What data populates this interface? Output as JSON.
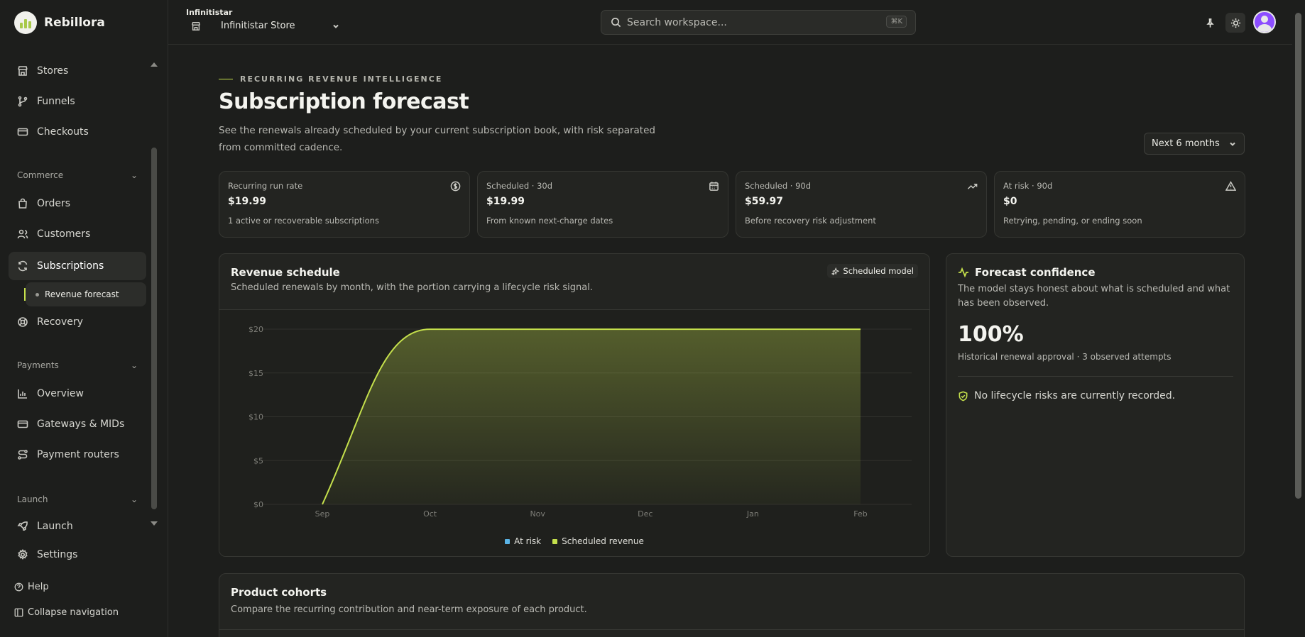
{
  "brand": {
    "name": "Rebillora"
  },
  "nav": {
    "stores": "Stores",
    "funnels": "Funnels",
    "checkouts": "Checkouts",
    "commerce_group": "Commerce",
    "orders": "Orders",
    "customers": "Customers",
    "subscriptions": "Subscriptions",
    "revenue_forecast": "Revenue forecast",
    "recovery": "Recovery",
    "payments_group": "Payments",
    "overview": "Overview",
    "gateways": "Gateways & MIDs",
    "routers": "Payment routers",
    "launch_group": "Launch",
    "launch": "Launch",
    "settings": "Settings",
    "help": "Help",
    "collapse": "Collapse navigation"
  },
  "topbar": {
    "workspace_label": "Infinitistar",
    "store": "Infinitistar Store",
    "search_placeholder": "Search workspace...",
    "shortcut": "⌘K"
  },
  "page": {
    "eyebrow": "RECURRING REVENUE INTELLIGENCE",
    "title": "Subscription forecast",
    "description": "See the renewals already scheduled by your current subscription book, with risk separated from committed cadence.",
    "range": "Next 6 months"
  },
  "stats": [
    {
      "label": "Recurring run rate",
      "value": "$19.99",
      "note": "1 active or recoverable subscriptions",
      "icon": "dollar-circle-icon"
    },
    {
      "label": "Scheduled · 30d",
      "value": "$19.99",
      "note": "From known next-charge dates",
      "icon": "calendar-icon"
    },
    {
      "label": "Scheduled · 90d",
      "value": "$59.97",
      "note": "Before recovery risk adjustment",
      "icon": "trending-up-icon"
    },
    {
      "label": "At risk · 90d",
      "value": "$0",
      "note": "Retrying, pending, or ending soon",
      "icon": "warning-icon"
    }
  ],
  "schedule": {
    "title": "Revenue schedule",
    "subtitle": "Scheduled renewals by month, with the portion carrying a lifecycle risk signal.",
    "badge": "Scheduled model"
  },
  "chart_data": {
    "type": "area",
    "categories": [
      "Sep",
      "Oct",
      "Nov",
      "Dec",
      "Jan",
      "Feb"
    ],
    "series": [
      {
        "name": "At risk",
        "values": [
          0,
          0,
          0,
          0,
          0,
          0
        ],
        "color": "#5ab4e6"
      },
      {
        "name": "Scheduled revenue",
        "values": [
          0,
          19.99,
          19.99,
          19.99,
          19.99,
          19.99
        ],
        "color": "#c5e04c"
      }
    ],
    "yticks": [
      "$0",
      "$5",
      "$10",
      "$15",
      "$20"
    ],
    "ylim": [
      0,
      20
    ],
    "grid": true,
    "legend": "bottom"
  },
  "confidence": {
    "title": "Forecast confidence",
    "description": "The model stays honest about what is scheduled and what has been observed.",
    "percent": "100%",
    "note": "Historical renewal approval · 3 observed attempts",
    "risk_note": "No lifecycle risks are currently recorded."
  },
  "cohorts": {
    "title": "Product cohorts",
    "subtitle": "Compare the recurring contribution and near-term exposure of each product."
  },
  "colors": {
    "accent": "#c5e04c",
    "background": "#1d1e1c",
    "card": "#232421",
    "avatar": "#8c4dff"
  }
}
